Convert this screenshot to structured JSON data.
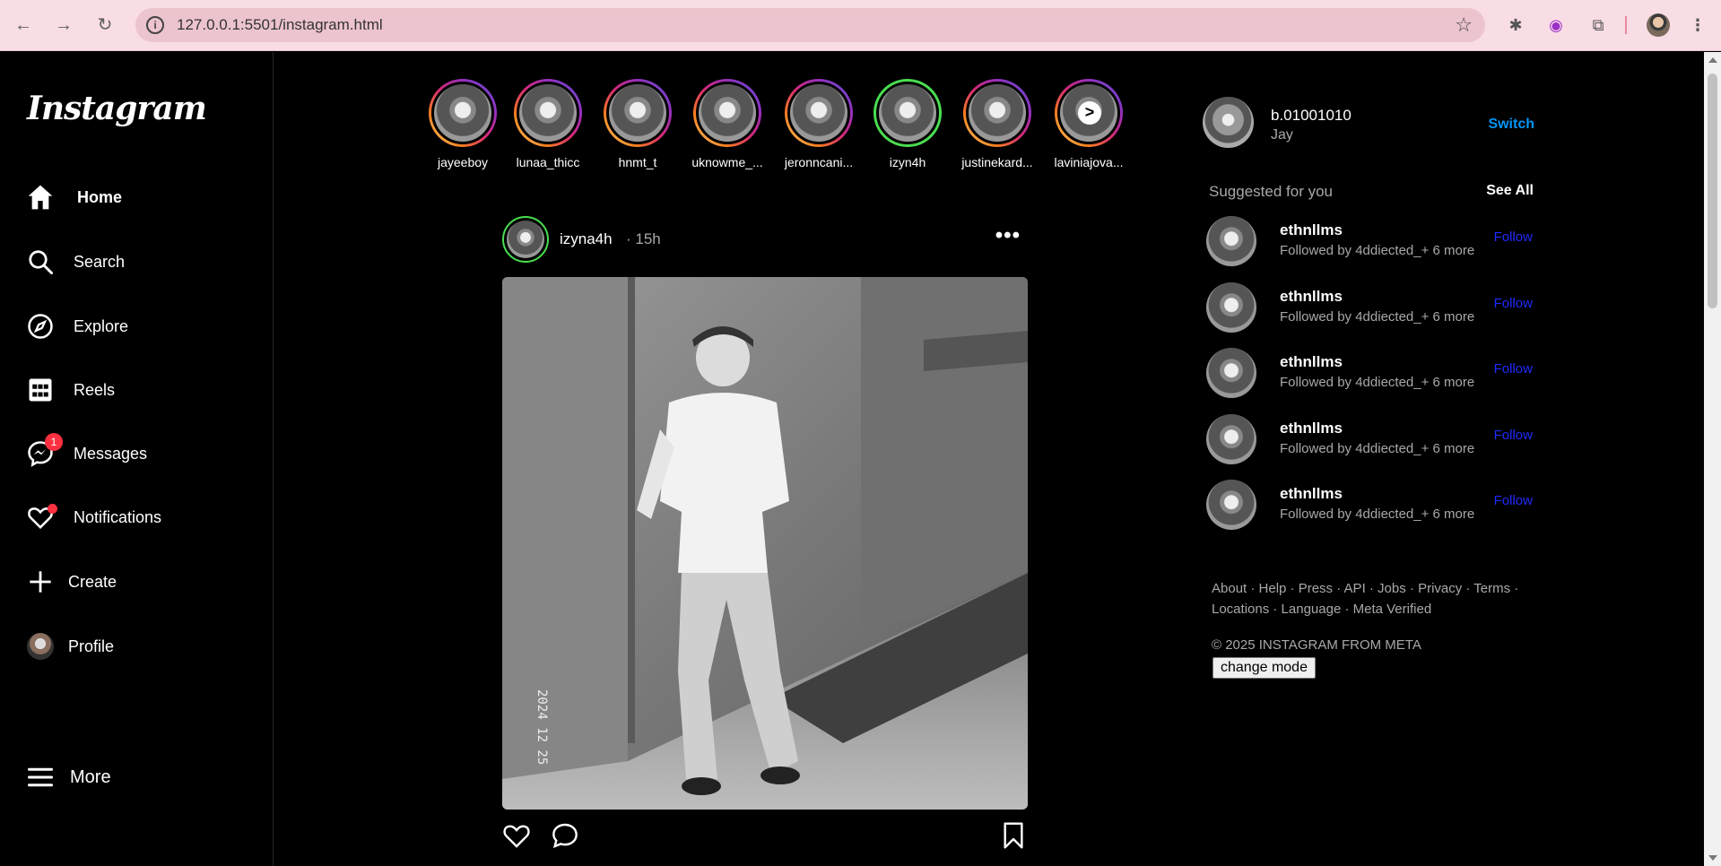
{
  "browser": {
    "url": "127.0.0.1:5501/instagram.html"
  },
  "sidebar": {
    "logo": "Instagram",
    "items": [
      {
        "label": "Home",
        "icon": "home-icon"
      },
      {
        "label": "Search",
        "icon": "search-icon"
      },
      {
        "label": "Explore",
        "icon": "compass-icon"
      },
      {
        "label": "Reels",
        "icon": "reels-icon"
      },
      {
        "label": "Messages",
        "icon": "messenger-icon",
        "badge": "1"
      },
      {
        "label": "Notifications",
        "icon": "heart-icon"
      },
      {
        "label": "Create",
        "icon": "plus-icon"
      },
      {
        "label": "Profile",
        "icon": "avatar"
      }
    ],
    "more_label": "More"
  },
  "stories": [
    {
      "name": "jayeeboy"
    },
    {
      "name": "lunaa_thicc"
    },
    {
      "name": "hnmt_t"
    },
    {
      "name": "uknowme_..."
    },
    {
      "name": "jeronncani..."
    },
    {
      "name": "izyn4h"
    },
    {
      "name": "justinekard..."
    },
    {
      "name": "laviniajova..."
    }
  ],
  "post": {
    "username": "izyna4h",
    "time": "· 15h",
    "photo_stamp": "2024 12 25"
  },
  "me": {
    "username": "b.01001010",
    "name": "Jay",
    "switch_label": "Switch"
  },
  "suggestions": {
    "title": "Suggested for you",
    "see_all": "See All",
    "items": [
      {
        "username": "ethnllms",
        "sub": "Followed by 4ddiected_+ 6 more",
        "action": "Follow"
      },
      {
        "username": "ethnllms",
        "sub": "Followed by 4ddiected_+ 6 more",
        "action": "Follow"
      },
      {
        "username": "ethnllms",
        "sub": "Followed by 4ddiected_+ 6 more",
        "action": "Follow"
      },
      {
        "username": "ethnllms",
        "sub": "Followed by 4ddiected_+ 6 more",
        "action": "Follow"
      },
      {
        "username": "ethnllms",
        "sub": "Followed by 4ddiected_+ 6 more",
        "action": "Follow"
      }
    ]
  },
  "footer": {
    "links_line1": "About · Help · Press · API · Jobs · Privacy · Terms ·",
    "links_line2": "Locations · Language · Meta Verified",
    "copyright": "© 2025 INSTAGRAM FROM META",
    "mode_button": "change mode"
  },
  "colors": {
    "background": "#000000",
    "link_blue": "#0095f6",
    "follow_blue": "#1f2bff",
    "badge_red": "#ff3040",
    "chrome_pink": "#f9dde4"
  }
}
